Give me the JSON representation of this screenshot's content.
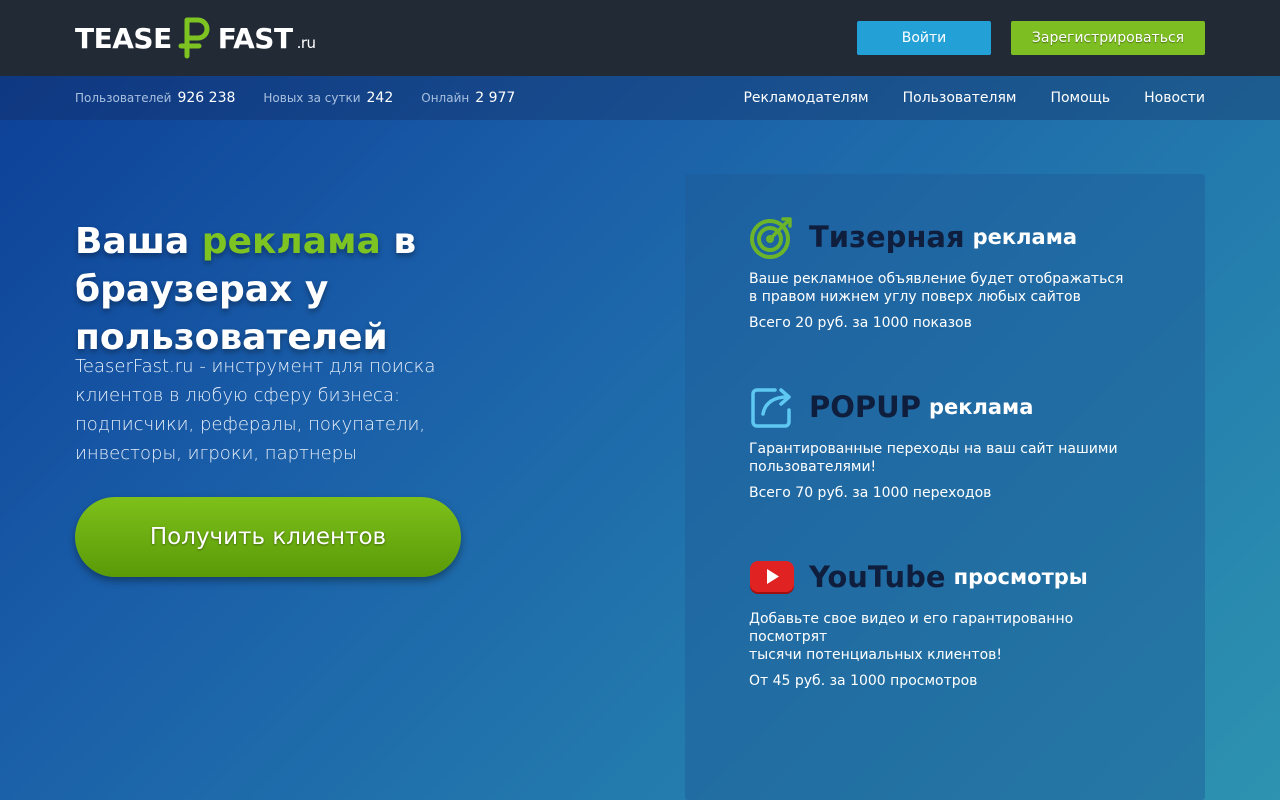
{
  "header": {
    "logo": {
      "part1": "TEASE",
      "part2": "FAST",
      "tld": ".ru",
      "symbol": "ruble-icon",
      "brand_color": "#7dc423"
    },
    "login_label": "Войти",
    "register_label": "Зарегистрироваться",
    "colors": {
      "login": "#23a0d6",
      "register": "#7dbe22",
      "bar": "#222a35"
    }
  },
  "stats": [
    {
      "label": "Пользователей",
      "value": "926 238"
    },
    {
      "label": "Новых за сутки",
      "value": "242"
    },
    {
      "label": "Онлайн",
      "value": "2 977"
    }
  ],
  "nav": [
    {
      "label": "Рекламодателям"
    },
    {
      "label": "Пользователям"
    },
    {
      "label": "Помощь"
    },
    {
      "label": "Новости"
    }
  ],
  "hero": {
    "title_start": "Ваша ",
    "title_accent": "реклама",
    "title_end": " в браузерах у пользователей",
    "description": "TeaserFast.ru - инструмент для поиска клиентов в любую сферу бизнеса: подписчики, рефералы, покупатели, инвесторы, игроки, партнеры",
    "cta_label": "Получить клиентов"
  },
  "offers": [
    {
      "icon": "target-icon",
      "name": "Тизерная",
      "suffix": "реклама",
      "description_line1": "Ваше рекламное объявление будет отображаться",
      "description_line2": "в правом нижнем углу поверх любых сайтов",
      "price": "Всего 20 руб. за 1000 показов"
    },
    {
      "icon": "share-icon",
      "name": "POPUP",
      "suffix": "реклама",
      "description_line1": "Гарантированные переходы на ваш сайт нашими",
      "description_line2": "пользователями!",
      "price": "Всего 70 руб. за 1000 переходов"
    },
    {
      "icon": "youtube-icon",
      "name": "YouTube",
      "suffix": "просмотры",
      "description_line1": "Добавьте свое видео и его гарантированно посмотрят",
      "description_line2": "тысячи потенциальных клиентов!",
      "price": "От 45 руб. за 1000 просмотров"
    }
  ]
}
